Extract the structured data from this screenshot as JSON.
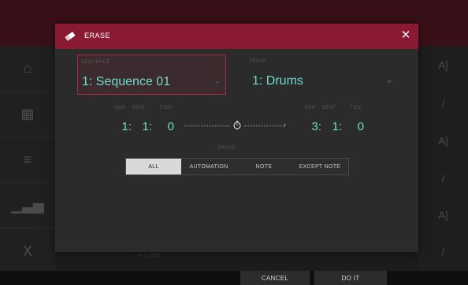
{
  "dialog": {
    "title": "ERASE",
    "sequence": {
      "label": "SEQUENCE",
      "value": "1: Sequence 01"
    },
    "track": {
      "label": "TRACK",
      "value": "1: Drums"
    },
    "start": {
      "labels": {
        "bar": "BAR",
        "beat": "BEAT",
        "tick": "TICK"
      },
      "bar": "1:",
      "beat": "1:",
      "tick": "0"
    },
    "end": {
      "labels": {
        "bar": "BAR",
        "beat": "BEAT",
        "tick": "TICK"
      },
      "bar": "3:",
      "beat": "1:",
      "tick": "0"
    },
    "erase_label": "ERASE",
    "erase_options": [
      "ALL",
      "AUTOMATION",
      "NOTE",
      "EXCEPT NOTE"
    ],
    "erase_selected": "ALL"
  },
  "footer": {
    "cancel_label": "CANCEL",
    "doit_label": "DO IT"
  },
  "background": {
    "ghost_text": "+ 1 snth"
  },
  "colors": {
    "header": "#8a1a32",
    "accent_text": "#6fdcc8",
    "selected_border": "#a32e40"
  }
}
